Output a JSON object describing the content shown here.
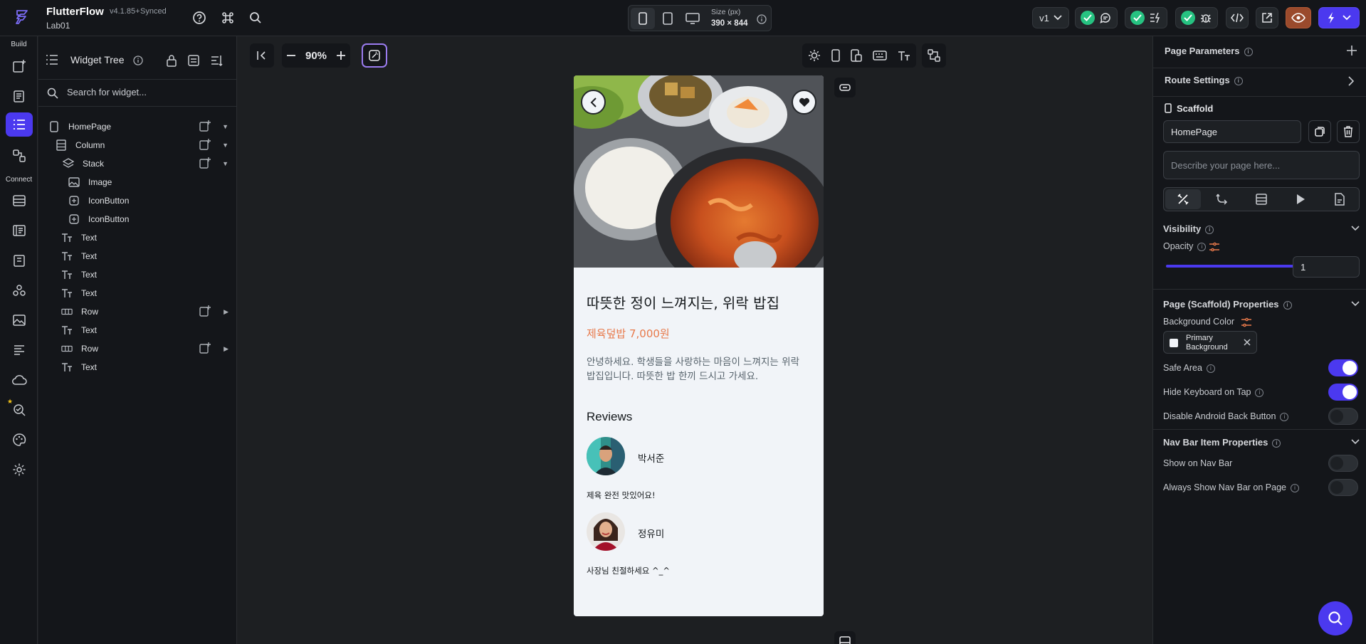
{
  "app": {
    "name": "FlutterFlow",
    "version": "v4.1.85+",
    "sync_status": "Synced",
    "project": "Lab01"
  },
  "device": {
    "size_label": "Size (px)",
    "size_value": "390 × 844"
  },
  "topbar": {
    "branch": "v1"
  },
  "rail": {
    "build_label": "Build",
    "connect_label": "Connect"
  },
  "tree": {
    "title": "Widget Tree",
    "search_placeholder": "Search for widget...",
    "items": [
      {
        "label": "HomePage",
        "icon": "phone-icon"
      },
      {
        "label": "Column",
        "icon": "column-icon"
      },
      {
        "label": "Stack",
        "icon": "stack-icon"
      },
      {
        "label": "Image",
        "icon": "image-icon"
      },
      {
        "label": "IconButton",
        "icon": "icon-button-icon"
      },
      {
        "label": "IconButton",
        "icon": "icon-button-icon"
      },
      {
        "label": "Text",
        "icon": "text-icon"
      },
      {
        "label": "Text",
        "icon": "text-icon"
      },
      {
        "label": "Text",
        "icon": "text-icon"
      },
      {
        "label": "Text",
        "icon": "text-icon"
      },
      {
        "label": "Row",
        "icon": "row-icon"
      },
      {
        "label": "Text",
        "icon": "text-icon"
      },
      {
        "label": "Row",
        "icon": "row-icon"
      },
      {
        "label": "Text",
        "icon": "text-icon"
      }
    ]
  },
  "canvas": {
    "zoom": "90%"
  },
  "phone": {
    "title": "따뜻한 정이 느껴지는, 위락 밥집",
    "price": "제육덮밥 7,000원",
    "description": "안녕하세요. 학생들을 사랑하는 마음이 느껴지는 위락밥집입니다. 따뜻한 밥 한끼 드시고 가세요.",
    "reviews_heading": "Reviews",
    "reviews": [
      {
        "name": "박서준",
        "comment": "제육 완전 맛있어요!"
      },
      {
        "name": "정유미",
        "comment": "사장님 친절하세요 ^_^"
      }
    ],
    "price_color": "#e8794a"
  },
  "props": {
    "page_parameters": "Page Parameters",
    "route_settings": "Route Settings",
    "scaffold_label": "Scaffold",
    "page_name": "HomePage",
    "describe_placeholder": "Describe your page here...",
    "visibility": "Visibility",
    "opacity_label": "Opacity",
    "opacity_value": "1",
    "opacity_fraction": 1,
    "scaffold_properties": "Page (Scaffold) Properties",
    "background_color_label": "Background Color",
    "background_color_value_line1": "Primary",
    "background_color_value_line2": "Background",
    "safe_area": "Safe Area",
    "hide_keyboard": "Hide Keyboard on Tap",
    "disable_back": "Disable Android Back Button",
    "nav_bar_props": "Nav Bar Item Properties",
    "show_on_nav": "Show on Nav Bar",
    "always_show_nav": "Always Show Nav Bar on Page",
    "accent": "#4b39ef"
  }
}
